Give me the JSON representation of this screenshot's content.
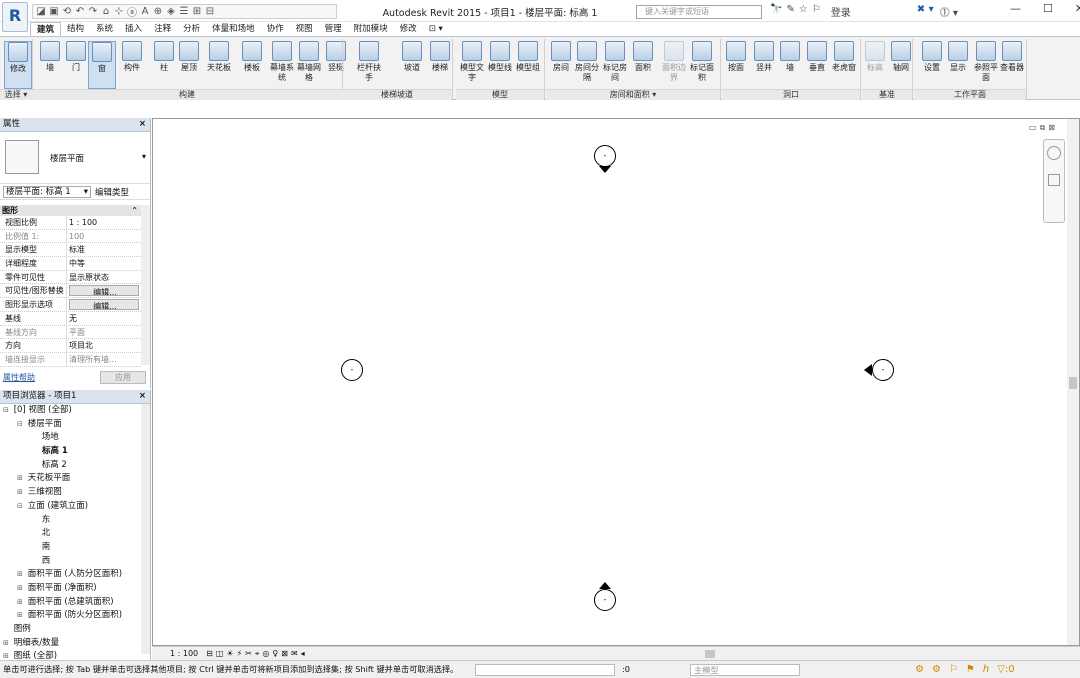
{
  "window": {
    "title": "Autodesk Revit 2015 -     项目1 - 楼层平面: 标高 1",
    "search_placeholder": "键入关键字或短语",
    "login_label": "登录",
    "app_letter": "R",
    "qat_icons": [
      "◪",
      "▣",
      "⟲",
      "↶",
      "↷",
      "⌂",
      "⊹",
      "ⓐ",
      "A",
      "⊕",
      "◈",
      "☰",
      "⊞",
      "⊟"
    ],
    "search_tools": [
      "🔭",
      "✎",
      "☆",
      "⚐"
    ],
    "win_controls": [
      "—",
      "☐",
      "✕"
    ]
  },
  "tabs": [
    "建筑",
    "结构",
    "系统",
    "插入",
    "注释",
    "分析",
    "体量和场地",
    "协作",
    "视图",
    "管理",
    "附加模块",
    "修改",
    "⊡ ▾"
  ],
  "active_tab_index": 0,
  "ribbon": {
    "buttons": [
      {
        "label": "修改",
        "selected": true
      },
      {
        "label": "墙"
      },
      {
        "label": "门"
      },
      {
        "label": "窗",
        "selected": true
      },
      {
        "label": "构件"
      },
      {
        "label": "柱"
      },
      {
        "label": "屋顶"
      },
      {
        "label": "天花板"
      },
      {
        "label": "楼板"
      },
      {
        "label": "幕墙系统"
      },
      {
        "label": "幕墙网格"
      },
      {
        "label": "竖梃"
      },
      {
        "label": "栏杆扶手"
      },
      {
        "label": "坡道"
      },
      {
        "label": "楼梯"
      },
      {
        "label": "模型文字"
      },
      {
        "label": "模型线"
      },
      {
        "label": "模型组"
      },
      {
        "label": "房间"
      },
      {
        "label": "房间分隔"
      },
      {
        "label": "标记房间"
      },
      {
        "label": "面积"
      },
      {
        "label": "面积边界",
        "disabled": true
      },
      {
        "label": "标记面积"
      },
      {
        "label": "按面"
      },
      {
        "label": "竖井"
      },
      {
        "label": "墙"
      },
      {
        "label": "垂直"
      },
      {
        "label": "老虎窗"
      },
      {
        "label": "标高",
        "disabled": true
      },
      {
        "label": "轴网"
      },
      {
        "label": "设置"
      },
      {
        "label": "显示"
      },
      {
        "label": "参照平面"
      },
      {
        "label": "查看器"
      }
    ],
    "groups": [
      "选择 ▾",
      "构建",
      "楼梯坡道",
      "模型",
      "房间和面积 ▾",
      "洞口",
      "基准",
      "工作平面"
    ]
  },
  "properties": {
    "title": "属性",
    "type_name": "楼层平面",
    "instance_label": "楼层平面: 标高 1",
    "edit_type": "编辑类型",
    "category": "图形",
    "rows": [
      {
        "k": "视图比例",
        "v": "1 : 100"
      },
      {
        "k": "比例值 1:",
        "v": "100",
        "gray": true
      },
      {
        "k": "显示模型",
        "v": "标准"
      },
      {
        "k": "详细程度",
        "v": "中等"
      },
      {
        "k": "零件可见性",
        "v": "显示原状态"
      },
      {
        "k": "可见性/图形替换",
        "v": "编辑...",
        "btn": true
      },
      {
        "k": "图形显示选项",
        "v": "编辑...",
        "btn": true
      },
      {
        "k": "基线",
        "v": "无"
      },
      {
        "k": "基线方向",
        "v": "平面",
        "gray": true
      },
      {
        "k": "方向",
        "v": "项目北"
      },
      {
        "k": "墙连接显示",
        "v": "清理所有墙...",
        "gray": true
      }
    ],
    "help_link": "属性帮助",
    "apply": "应用"
  },
  "browser": {
    "title": "项目浏览器 - 项目1",
    "nodes": [
      {
        "label": "[0] 视图 (全部)",
        "indent": 0,
        "pm": "⊟"
      },
      {
        "label": "楼层平面",
        "indent": 1,
        "pm": "⊟"
      },
      {
        "label": "场地",
        "indent": 2,
        "pm": ""
      },
      {
        "label": "标高 1",
        "indent": 2,
        "pm": "",
        "bold": true
      },
      {
        "label": "标高 2",
        "indent": 2,
        "pm": ""
      },
      {
        "label": "天花板平面",
        "indent": 1,
        "pm": "⊞"
      },
      {
        "label": "三维视图",
        "indent": 1,
        "pm": "⊞"
      },
      {
        "label": "立面 (建筑立面)",
        "indent": 1,
        "pm": "⊟"
      },
      {
        "label": "东",
        "indent": 2,
        "pm": ""
      },
      {
        "label": "北",
        "indent": 2,
        "pm": ""
      },
      {
        "label": "南",
        "indent": 2,
        "pm": ""
      },
      {
        "label": "西",
        "indent": 2,
        "pm": ""
      },
      {
        "label": "面积平面 (人防分区面积)",
        "indent": 1,
        "pm": "⊞"
      },
      {
        "label": "面积平面 (净面积)",
        "indent": 1,
        "pm": "⊞"
      },
      {
        "label": "面积平面 (总建筑面积)",
        "indent": 1,
        "pm": "⊞"
      },
      {
        "label": "面积平面 (防火分区面积)",
        "indent": 1,
        "pm": "⊞"
      },
      {
        "label": "图例",
        "indent": 0,
        "pm": ""
      },
      {
        "label": "明细表/数量",
        "indent": 0,
        "pm": "⊞"
      },
      {
        "label": "图纸 (全部)",
        "indent": 0,
        "pm": "⊞"
      }
    ]
  },
  "view_control": {
    "scale": "1 : 100",
    "icons": [
      "⊟",
      "◫",
      "☀",
      "⚡",
      "✂",
      "⌖",
      "◎",
      "♀",
      "⊠",
      "✉",
      "◂"
    ]
  },
  "status": {
    "text": "单击可进行选择; 按 Tab 键并单击可选择其他项目; 按 Ctrl 键并单击可将新项目添加到选择集; 按 Shift 键并单击可取消选择。",
    "zero": ":0",
    "model": "主模型",
    "icons": [
      "⚙",
      "⚙",
      "⚐",
      "⚑",
      "ℎ",
      "▽:0"
    ]
  },
  "markers": {
    "label": "-"
  }
}
